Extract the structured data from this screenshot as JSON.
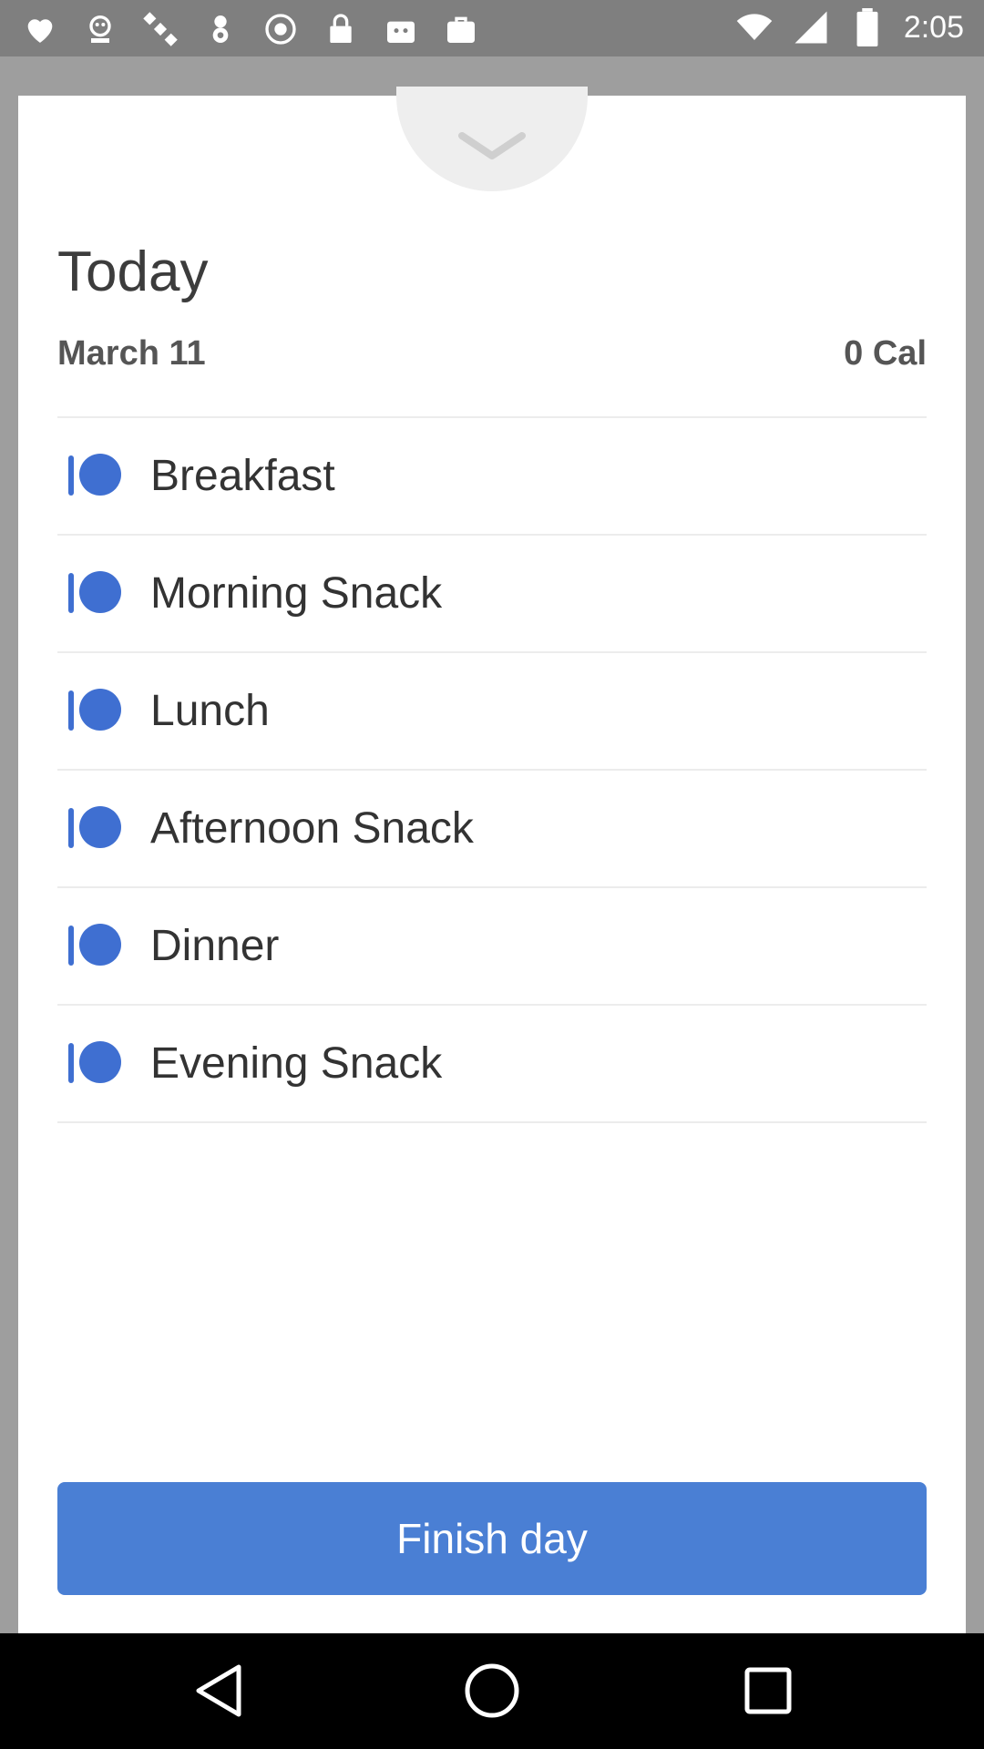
{
  "status_bar": {
    "time": "2:05",
    "icons": [
      "heart-icon",
      "bot-icon",
      "fake-gps-icon",
      "location-icon",
      "circle-icon",
      "lock-icon",
      "bag-icon",
      "bag-icon"
    ]
  },
  "sheet": {
    "title": "Today",
    "date": "March 11",
    "calories": "0 Cal",
    "meals": [
      {
        "label": "Breakfast"
      },
      {
        "label": "Morning Snack"
      },
      {
        "label": "Lunch"
      },
      {
        "label": "Afternoon Snack"
      },
      {
        "label": "Dinner"
      },
      {
        "label": "Evening Snack"
      }
    ],
    "finish_label": "Finish day"
  },
  "colors": {
    "accent": "#4a7fd4",
    "icon": "#3f6fd1"
  }
}
